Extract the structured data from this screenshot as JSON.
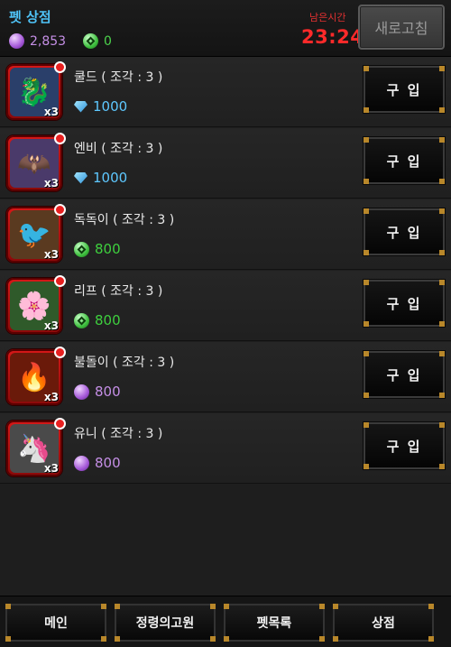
{
  "header": {
    "title": "펫 상점",
    "purple_currency": "2,853",
    "green_currency": "0",
    "timer_label": "남은시간",
    "timer": "23:24",
    "refresh_label": "새로고침"
  },
  "items": [
    {
      "name": "쿨드 ( 조각 : 3 )",
      "qty": "x3",
      "price": "1000",
      "currency": "diamond",
      "icon": "ice-dragon-pet-icon",
      "glyph": "🐉",
      "buy_label": "구 입"
    },
    {
      "name": "엔비 ( 조각 : 3 )",
      "qty": "x3",
      "price": "1000",
      "currency": "diamond",
      "icon": "purple-bat-pet-icon",
      "glyph": "🦇",
      "buy_label": "구 입"
    },
    {
      "name": "독독이 ( 조각 : 3 )",
      "qty": "x3",
      "price": "800",
      "currency": "green",
      "icon": "bird-pet-icon",
      "glyph": "🐦",
      "buy_label": "구 입"
    },
    {
      "name": "리프 ( 조각 : 3 )",
      "qty": "x3",
      "price": "800",
      "currency": "green",
      "icon": "leaf-flower-pet-icon",
      "glyph": "🌸",
      "buy_label": "구 입"
    },
    {
      "name": "불돌이 ( 조각 : 3 )",
      "qty": "x3",
      "price": "800",
      "currency": "purple",
      "icon": "fire-pet-icon",
      "glyph": "🔥",
      "buy_label": "구 입"
    },
    {
      "name": "유니 ( 조각 : 3 )",
      "qty": "x3",
      "price": "800",
      "currency": "purple",
      "icon": "unicorn-pet-icon",
      "glyph": "🦄",
      "buy_label": "구 입"
    }
  ],
  "nav": {
    "main": "메인",
    "spirit": "정령의고원",
    "pet_list": "펫목록",
    "shop": "상점"
  },
  "colors": {
    "title": "#4fc3f7",
    "timer": "#ff2a2a",
    "diamond": "#5ec8ff",
    "green": "#3ed03e",
    "purple": "#c58fe6",
    "icon_frame": "#d61818",
    "button_corner": "#b8872a"
  }
}
